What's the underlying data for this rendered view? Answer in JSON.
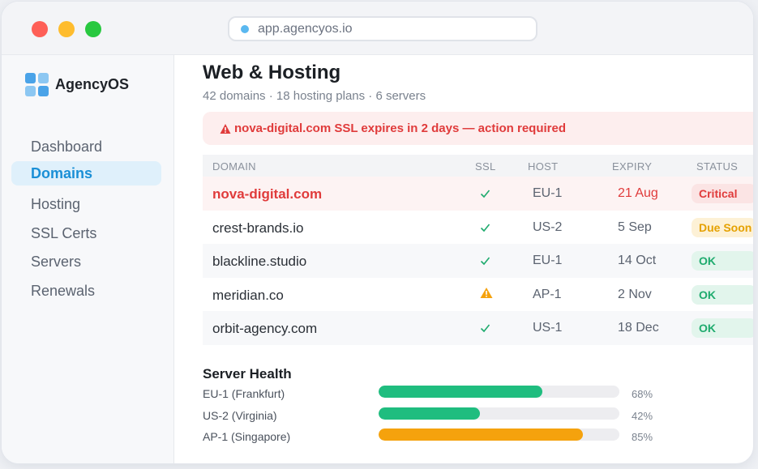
{
  "browser": {
    "url": "app.agencyos.io"
  },
  "sidebar": {
    "brand": "AgencyOS",
    "items": [
      {
        "label": "Dashboard",
        "active": false
      },
      {
        "label": "Domains",
        "active": true
      },
      {
        "label": "Hosting",
        "active": false
      },
      {
        "label": "SSL Certs",
        "active": false
      },
      {
        "label": "Servers",
        "active": false
      },
      {
        "label": "Renewals",
        "active": false
      }
    ]
  },
  "page": {
    "title": "Web & Hosting",
    "subtitle": "42 domains · 18 hosting plans · 6 servers"
  },
  "alert": {
    "icon": "warning-icon",
    "text": "nova-digital.com SSL expires in 2 days — action required"
  },
  "table": {
    "columns": [
      "DOMAIN",
      "SSL",
      "HOST",
      "EXPIRY",
      "STATUS"
    ],
    "rows": [
      {
        "domain": "nova-digital.com",
        "ssl": "check",
        "host": "EU-1",
        "expiry": "21 Aug",
        "status": "Critical"
      },
      {
        "domain": "crest-brands.io",
        "ssl": "check",
        "host": "US-2",
        "expiry": "5 Sep",
        "status": "Due Soon"
      },
      {
        "domain": "blackline.studio",
        "ssl": "check",
        "host": "EU-1",
        "expiry": "14 Oct",
        "status": "OK"
      },
      {
        "domain": "meridian.co",
        "ssl": "warning",
        "host": "AP-1",
        "expiry": "2 Nov",
        "status": "OK"
      },
      {
        "domain": "orbit-agency.com",
        "ssl": "check",
        "host": "US-1",
        "expiry": "18 Dec",
        "status": "OK"
      }
    ]
  },
  "server_health": {
    "title": "Server Health",
    "servers": [
      {
        "label": "EU-1 (Frankfurt)",
        "percent_label": "68%",
        "value": 68,
        "color": "#1fbd7f"
      },
      {
        "label": "US-2 (Virginia)",
        "percent_label": "42%",
        "value": 42,
        "color": "#1fbd7f"
      },
      {
        "label": "AP-1 (Singapore)",
        "percent_label": "85%",
        "value": 85,
        "color": "#f5a20d"
      }
    ]
  },
  "colors": {
    "accent": "#1a8fd6",
    "critical": "#e03b3b",
    "warning": "#f5a20d",
    "ok": "#1fab6e"
  }
}
